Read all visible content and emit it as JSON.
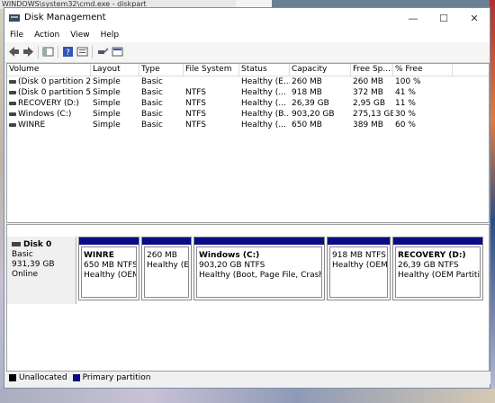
{
  "background": {
    "cmd_title": "WINDOWS\\system32\\cmd.exe - diskpart"
  },
  "window": {
    "title": "Disk Management",
    "minimize": "—",
    "maximize": "☐",
    "close": "✕"
  },
  "menu": [
    "File",
    "Action",
    "View",
    "Help"
  ],
  "table": {
    "columns": [
      "Volume",
      "Layout",
      "Type",
      "File System",
      "Status",
      "Capacity",
      "Free Sp...",
      "% Free"
    ],
    "rows": [
      [
        "(Disk 0 partition 2)",
        "Simple",
        "Basic",
        "",
        "Healthy (E...",
        "260 MB",
        "260 MB",
        "100 %"
      ],
      [
        "(Disk 0 partition 5)",
        "Simple",
        "Basic",
        "NTFS",
        "Healthy (...",
        "918 MB",
        "372 MB",
        "41 %"
      ],
      [
        "RECOVERY (D:)",
        "Simple",
        "Basic",
        "NTFS",
        "Healthy (...",
        "26,39 GB",
        "2,95 GB",
        "11 %"
      ],
      [
        "Windows (C:)",
        "Simple",
        "Basic",
        "NTFS",
        "Healthy (B...",
        "903,20 GB",
        "275,13 GB",
        "30 %"
      ],
      [
        "WINRE",
        "Simple",
        "Basic",
        "NTFS",
        "Healthy (...",
        "650 MB",
        "389 MB",
        "60 %"
      ]
    ]
  },
  "disk": {
    "name": "Disk 0",
    "type": "Basic",
    "size": "931,39 GB",
    "state": "Online"
  },
  "partitions": [
    {
      "name": "WINRE",
      "size": "650 MB NTFS",
      "status": "Healthy (OEM I"
    },
    {
      "name": "",
      "size": "260 MB",
      "status": "Healthy (EFI"
    },
    {
      "name": "Windows  (C:)",
      "size": "903,20 GB NTFS",
      "status": "Healthy (Boot, Page File, Crash Dun"
    },
    {
      "name": "",
      "size": "918 MB NTFS",
      "status": "Healthy (OEM P"
    },
    {
      "name": "RECOVERY  (D:)",
      "size": "26,39 GB NTFS",
      "status": "Healthy (OEM Partition)"
    }
  ],
  "legend": [
    {
      "label": "Unallocated",
      "color": "#000000"
    },
    {
      "label": "Primary partition",
      "color": "#0b0b84"
    }
  ]
}
